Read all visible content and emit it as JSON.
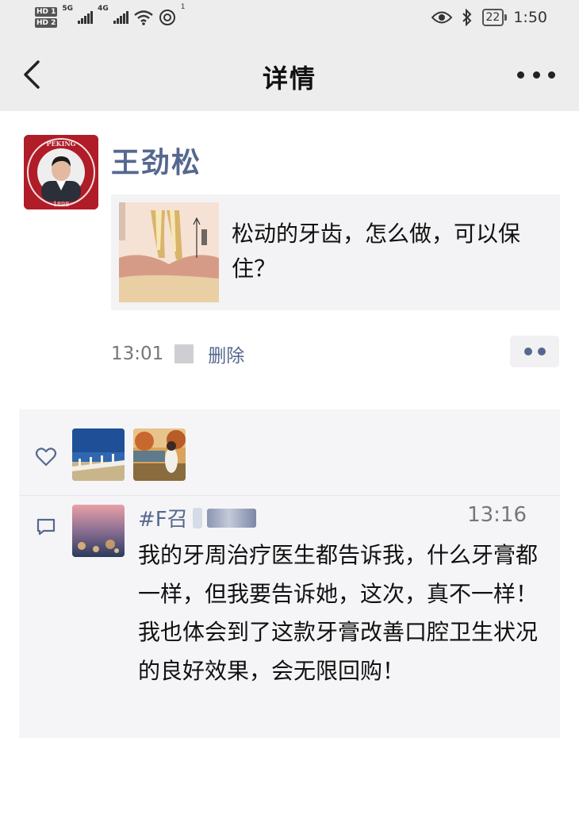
{
  "status_bar": {
    "hd1": "HD 1",
    "hd2": "HD 2",
    "net1": "5G",
    "net2": "4G",
    "nfc_badge": "1",
    "battery": "22",
    "time": "1:50"
  },
  "nav": {
    "title": "详情",
    "back_icon": "chevron-left-icon",
    "more_icon": "more-dots-icon"
  },
  "post": {
    "author": "王劲松",
    "avatar_icon": "peking-university-avatar",
    "avatar_seal_text": "PEKING UNIVERSITY 1898",
    "link_title": "松动的牙齿，怎么做，可以保住？",
    "time": "13:01",
    "delete_label": "删除",
    "action_icon": "two-dots-icon"
  },
  "interactions": {
    "like_icon": "heart-outline-icon",
    "likers": [
      {
        "name": "liker-avatar-bridge"
      },
      {
        "name": "liker-avatar-girl"
      }
    ],
    "comment_icon": "comment-bubble-icon",
    "comments": [
      {
        "name_prefix": "#F召",
        "time": "13:16",
        "text": "我的牙周治疗医生都告诉我，什么牙膏都一样，但我要告诉她，这次，真不一样！我也体会到了这款牙膏改善口腔卫生状况的良好效果，会无限回购！"
      }
    ]
  },
  "colors": {
    "chrome_bg": "#ededed",
    "link_blue": "#56688f",
    "panel_bg": "#f5f5f7",
    "avatar_red": "#b01c28"
  }
}
